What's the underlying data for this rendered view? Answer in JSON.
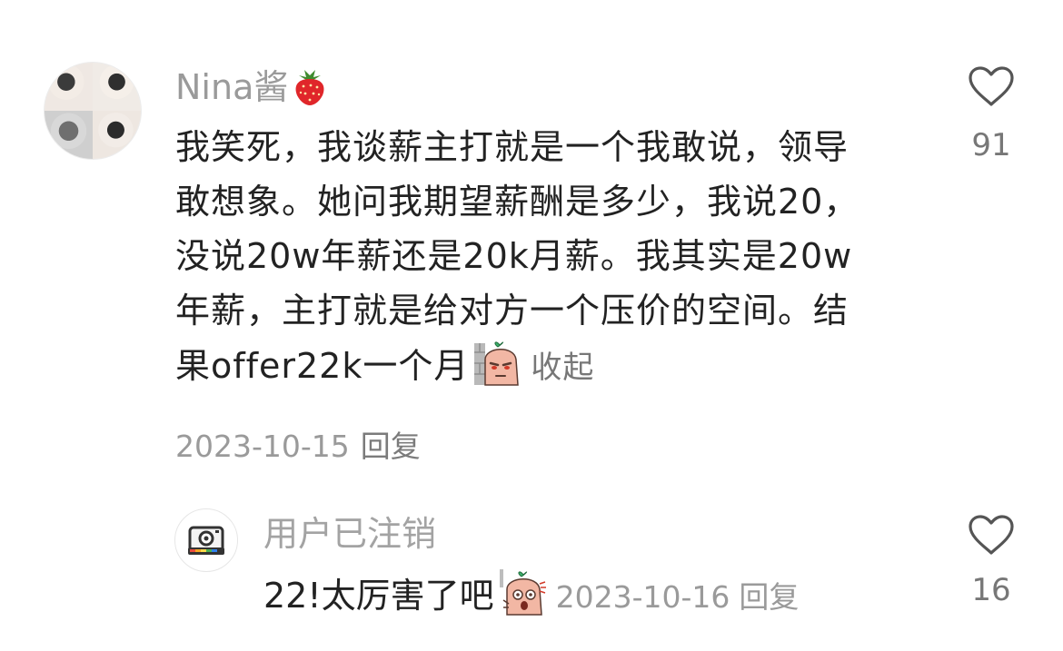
{
  "main_comment": {
    "username": "Nina酱",
    "text_lines": [
      "我笑死，我谈薪主打就是一个我敢说，领导",
      "敢想象。她问我期望薪酬是多少，我说20，",
      "没说20w年薪还是20k月薪。我其实是20w",
      "年薪，主打就是给对方一个压价的空间。结",
      "果offer22k一个月"
    ],
    "collapse_label": "收起",
    "date": "2023-10-15",
    "reply_label": "回复",
    "like_count": "91"
  },
  "reply_comment": {
    "username": "用户已注销",
    "text": "22!太厉害了吧",
    "date": "2023-10-16",
    "reply_label": "回复",
    "like_count": "16"
  },
  "icons": {
    "like": "heart-outline-icon",
    "username_emoji": "strawberry-icon",
    "sticker_main": "peeking-sticker",
    "sticker_reply": "shocked-sticker",
    "reply_avatar": "camera-icon"
  },
  "colors": {
    "text": "#222222",
    "muted": "#9a9a9a",
    "link": "#777777",
    "background": "#ffffff"
  }
}
